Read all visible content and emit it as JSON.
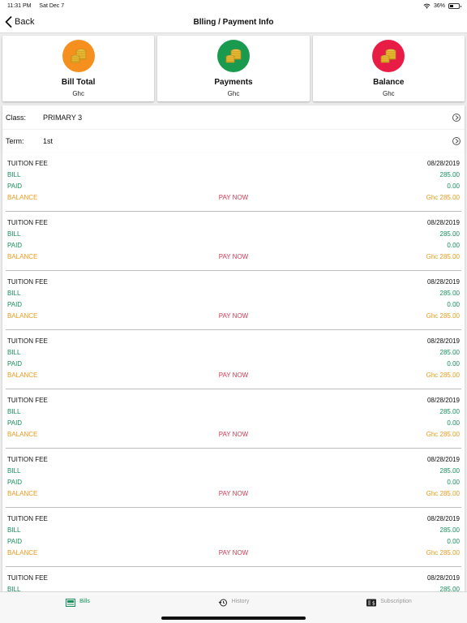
{
  "status_bar": {
    "time": "11:31 PM",
    "date": "Sat Dec 7",
    "battery": "36%",
    "battery_level": 0.36
  },
  "nav": {
    "back_label": "Back",
    "title": "Blling / Payment Info"
  },
  "summary": [
    {
      "label": "Bill Total",
      "value": "Ghc",
      "color": "#f5901e"
    },
    {
      "label": "Payments",
      "value": "Ghc",
      "color": "#1a9a4e"
    },
    {
      "label": "Balance",
      "value": "Ghc",
      "color": "#e81d46"
    }
  ],
  "filters": {
    "class_label": "Class:",
    "class_value": "PRIMARY 3",
    "term_label": "Term:",
    "term_value": "1st"
  },
  "bills": [
    {
      "name": "TUITION FEE",
      "date": "08/28/2019",
      "bill_label": "BILL",
      "bill": "285.00",
      "paid_label": "PAID",
      "paid": "0.00",
      "balance_label": "BALANCE",
      "pay": "PAY NOW",
      "balance": "Ghc 285.00"
    },
    {
      "name": "TUITION FEE",
      "date": "08/28/2019",
      "bill_label": "BILL",
      "bill": "285.00",
      "paid_label": "PAID",
      "paid": "0.00",
      "balance_label": "BALANCE",
      "pay": "PAY NOW",
      "balance": "Ghc 285.00"
    },
    {
      "name": "TUITION FEE",
      "date": "08/28/2019",
      "bill_label": "BILL",
      "bill": "285.00",
      "paid_label": "PAID",
      "paid": "0.00",
      "balance_label": "BALANCE",
      "pay": "PAY NOW",
      "balance": "Ghc 285.00"
    },
    {
      "name": "TUITION FEE",
      "date": "08/28/2019",
      "bill_label": "BILL",
      "bill": "285.00",
      "paid_label": "PAID",
      "paid": "0.00",
      "balance_label": "BALANCE",
      "pay": "PAY NOW",
      "balance": "Ghc 285.00"
    },
    {
      "name": "TUITION FEE",
      "date": "08/28/2019",
      "bill_label": "BILL",
      "bill": "285.00",
      "paid_label": "PAID",
      "paid": "0.00",
      "balance_label": "BALANCE",
      "pay": "PAY NOW",
      "balance": "Ghc 285.00"
    },
    {
      "name": "TUITION FEE",
      "date": "08/28/2019",
      "bill_label": "BILL",
      "bill": "285.00",
      "paid_label": "PAID",
      "paid": "0.00",
      "balance_label": "BALANCE",
      "pay": "PAY NOW",
      "balance": "Ghc 285.00"
    },
    {
      "name": "TUITION FEE",
      "date": "08/28/2019",
      "bill_label": "BILL",
      "bill": "285.00",
      "paid_label": "PAID",
      "paid": "0.00",
      "balance_label": "BALANCE",
      "pay": "PAY NOW",
      "balance": "Ghc 285.00"
    },
    {
      "name": "TUITION FEE",
      "date": "08/28/2019",
      "bill_label": "BILL",
      "bill": "285.00",
      "paid_label": "",
      "paid": "",
      "balance_label": "",
      "pay": "",
      "balance": ""
    }
  ],
  "tabs": [
    {
      "label": "Bills",
      "icon": "bills-icon",
      "active": true
    },
    {
      "label": "History",
      "icon": "history-icon",
      "active": false
    },
    {
      "label": "Subscription",
      "icon": "subscription-icon",
      "active": false
    }
  ],
  "colors": {
    "accent_green": "#14915a",
    "balance_orange": "#e69b1e",
    "pay_red": "#d23a52"
  }
}
